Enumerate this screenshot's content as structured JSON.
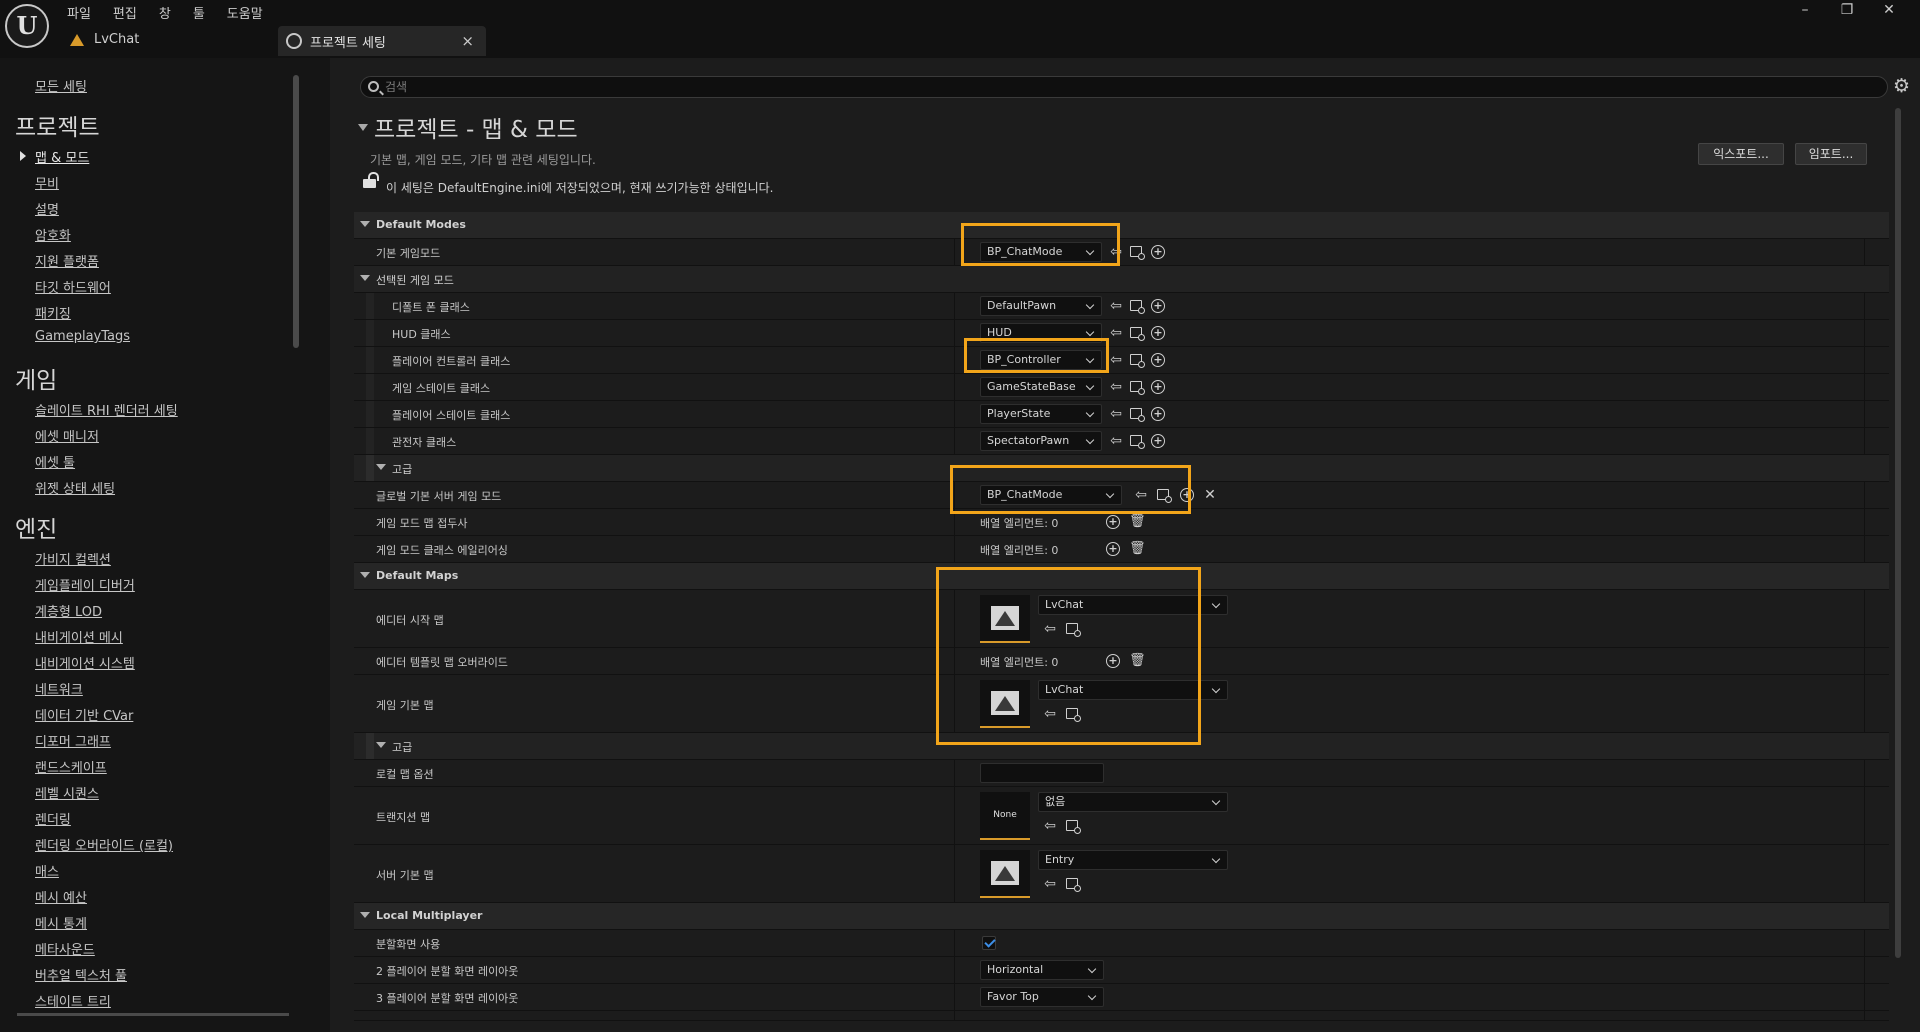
{
  "titlebar": {
    "logo": "U",
    "menu": [
      "파일",
      "편집",
      "창",
      "툴",
      "도움말"
    ],
    "project_name": "LvChat",
    "tab_label": "프로젝트 세팅",
    "tab_close": "×",
    "win_min": "–",
    "win_max": "❐",
    "win_close": "✕"
  },
  "sidebar": {
    "all_settings": "모든 세팅",
    "sections": [
      {
        "header": "프로젝트",
        "items": [
          "맵 & 모드",
          "무비",
          "설명",
          "암호화",
          "지원 플랫폼",
          "타깃 하드웨어",
          "패키징",
          "GameplayTags"
        ]
      },
      {
        "header": "게임",
        "items": [
          "슬레이트 RHI 렌더러 세팅",
          "에셋 매니저",
          "에셋 툴",
          "위젯 상태 세팅"
        ]
      },
      {
        "header": "엔진",
        "items": [
          "가비지 컬렉션",
          "게임플레이 디버거",
          "계층형 LOD",
          "내비게이션 메시",
          "내비게이션 시스템",
          "네트워크",
          "데이터 기반 CVar",
          "디포머 그래프",
          "랜드스케이프",
          "레벨 시퀀스",
          "렌더링",
          "렌더링 오버라이드 (로컬)",
          "매스",
          "메시 예산",
          "메시 통계",
          "메타사운드",
          "버추얼 텍스처 풀",
          "스테이트 트리"
        ]
      }
    ],
    "active_item": "맵 & 모드"
  },
  "search": {
    "placeholder": "검색",
    "value": ""
  },
  "header": {
    "title": "프로젝트 - 맵 & 모드",
    "description": "기본 맵, 게임 모드, 기타 맵 관련 세팅입니다.",
    "save_info": "이 세팅은 DefaultEngine.ini에 저장되었으며, 현재 쓰기가능한 상태입니다.",
    "export_label": "익스포트...",
    "import_label": "임포트..."
  },
  "icons": {
    "browse": "browse-icon",
    "use_selected": "use-selected-icon",
    "add": "add-icon",
    "clear": "clear-icon",
    "delete": "trash-icon",
    "settings": "gear-icon"
  },
  "grid": {
    "default_modes": {
      "label": "Default Modes",
      "default_gamemode": {
        "name": "기본 게임모드",
        "value": "BP_ChatMode"
      },
      "selected_gamemode": {
        "label": "선택된 게임 모드",
        "pawn": {
          "name": "디폴트 폰 클래스",
          "value": "DefaultPawn"
        },
        "hud": {
          "name": "HUD 클래스",
          "value": "HUD"
        },
        "controller": {
          "name": "플레이어 컨트롤러 클래스",
          "value": "BP_Controller"
        },
        "gamestate": {
          "name": "게임 스테이트 클래스",
          "value": "GameStateBase"
        },
        "playerstate": {
          "name": "플레이어 스테이트 클래스",
          "value": "PlayerState"
        },
        "spectator": {
          "name": "관전자 클래스",
          "value": "SpectatorPawn"
        }
      },
      "advanced": {
        "label": "고급",
        "global_server_mode": {
          "name": "글로벌 기본 서버 게임 모드",
          "value": "BP_ChatMode"
        },
        "map_prefixes": {
          "name": "게임 모드 맵 접두사",
          "value": "배열 엘리먼트: 0"
        },
        "class_aliases": {
          "name": "게임 모드 클래스 에일리어싱",
          "value": "배열 엘리먼트: 0"
        }
      }
    },
    "default_maps": {
      "label": "Default Maps",
      "editor_startup_map": {
        "name": "에디터 시작 맵",
        "value": "LvChat"
      },
      "editor_template_override": {
        "name": "에디터 템플릿 맵 오버라이드",
        "value": "배열 엘리먼트: 0"
      },
      "game_default_map": {
        "name": "게임 기본 맵",
        "value": "LvChat"
      },
      "advanced": {
        "label": "고급",
        "local_map_options": {
          "name": "로컬 맵 옵션",
          "value": ""
        },
        "transition_map": {
          "name": "트랜지션 맵",
          "value": "없음",
          "thumb": "None"
        },
        "server_default_map": {
          "name": "서버 기본 맵",
          "value": "Entry"
        }
      }
    },
    "local_multiplayer": {
      "label": "Local Multiplayer",
      "use_splitscreen": {
        "name": "분할화면 사용",
        "checked": true
      },
      "two_player_layout": {
        "name": "2 플레이어 분할 화면 레이아웃",
        "value": "Horizontal"
      },
      "three_player_layout": {
        "name": "3 플레이어 분할 화면 레이아웃",
        "value": "Favor Top"
      }
    }
  },
  "colors": {
    "highlight": "#f2a51a",
    "accent": "#d89a2a",
    "checkbox": "#3d8ee6"
  }
}
